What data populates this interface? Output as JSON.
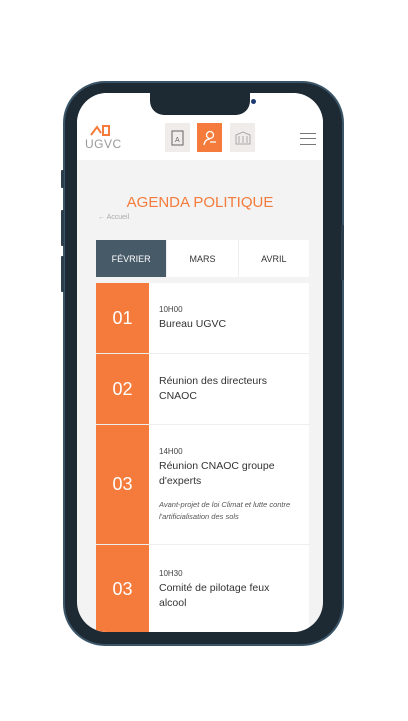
{
  "header": {
    "logo": "UGVC",
    "icons": [
      "book-icon",
      "user-link-icon",
      "building-icon"
    ]
  },
  "page": {
    "title": "AGENDA POLITIQUE",
    "back": "Accueil"
  },
  "tabs": [
    {
      "label": "FÉVRIER",
      "active": true
    },
    {
      "label": "MARS"
    },
    {
      "label": "AVRIL"
    }
  ],
  "events": [
    {
      "day": "01",
      "time": "10H00",
      "name": "Bureau UGVC"
    },
    {
      "day": "02",
      "name": "Réunion des directeurs CNAOC"
    },
    {
      "day": "03",
      "time": "14H00",
      "name": "Réunion CNAOC groupe d'experts",
      "desc": "Avant-projet de loi Climat et lutte contre l'artificialisation des sols"
    },
    {
      "day": "03",
      "time": "10H30",
      "name": "Comité de pilotage feux alcool"
    }
  ],
  "colors": {
    "accent": "#f47b3b",
    "tab_active": "#475a68"
  }
}
